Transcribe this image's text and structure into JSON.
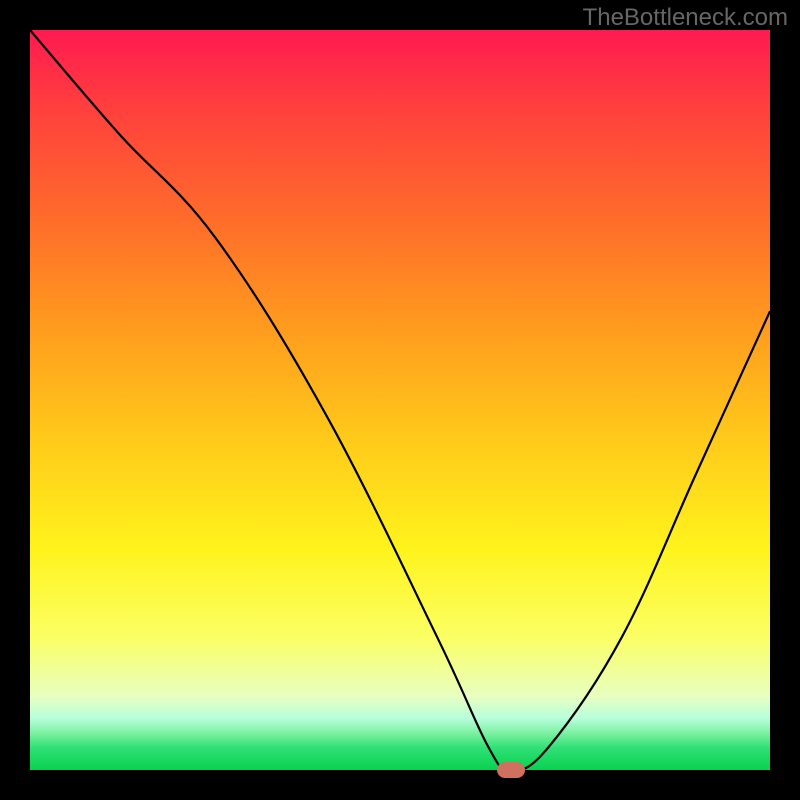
{
  "watermark": "TheBottleneck.com",
  "chart_data": {
    "type": "line",
    "title": "",
    "xlabel": "",
    "ylabel": "",
    "xlim": [
      0,
      100
    ],
    "ylim": [
      0,
      100
    ],
    "series": [
      {
        "name": "curve",
        "x": [
          0,
          12,
          25,
          40,
          55,
          62,
          65,
          70,
          80,
          90,
          100
        ],
        "values": [
          100,
          86,
          72,
          48,
          18,
          3,
          0,
          3,
          18,
          40,
          62
        ]
      }
    ],
    "marker": {
      "x": 65,
      "y": 0
    },
    "gradient_stops": [
      {
        "pos": 0,
        "color": "#ff1a50"
      },
      {
        "pos": 10,
        "color": "#ff3e3e"
      },
      {
        "pos": 25,
        "color": "#ff6a2b"
      },
      {
        "pos": 40,
        "color": "#ff9b1e"
      },
      {
        "pos": 55,
        "color": "#ffc91a"
      },
      {
        "pos": 70,
        "color": "#fff31c"
      },
      {
        "pos": 82,
        "color": "#fbff64"
      },
      {
        "pos": 90,
        "color": "#e8ffc0"
      },
      {
        "pos": 93,
        "color": "#b6ffdc"
      },
      {
        "pos": 95,
        "color": "#7cf2a0"
      },
      {
        "pos": 97,
        "color": "#2fe076"
      },
      {
        "pos": 100,
        "color": "#0ad14f"
      }
    ]
  }
}
